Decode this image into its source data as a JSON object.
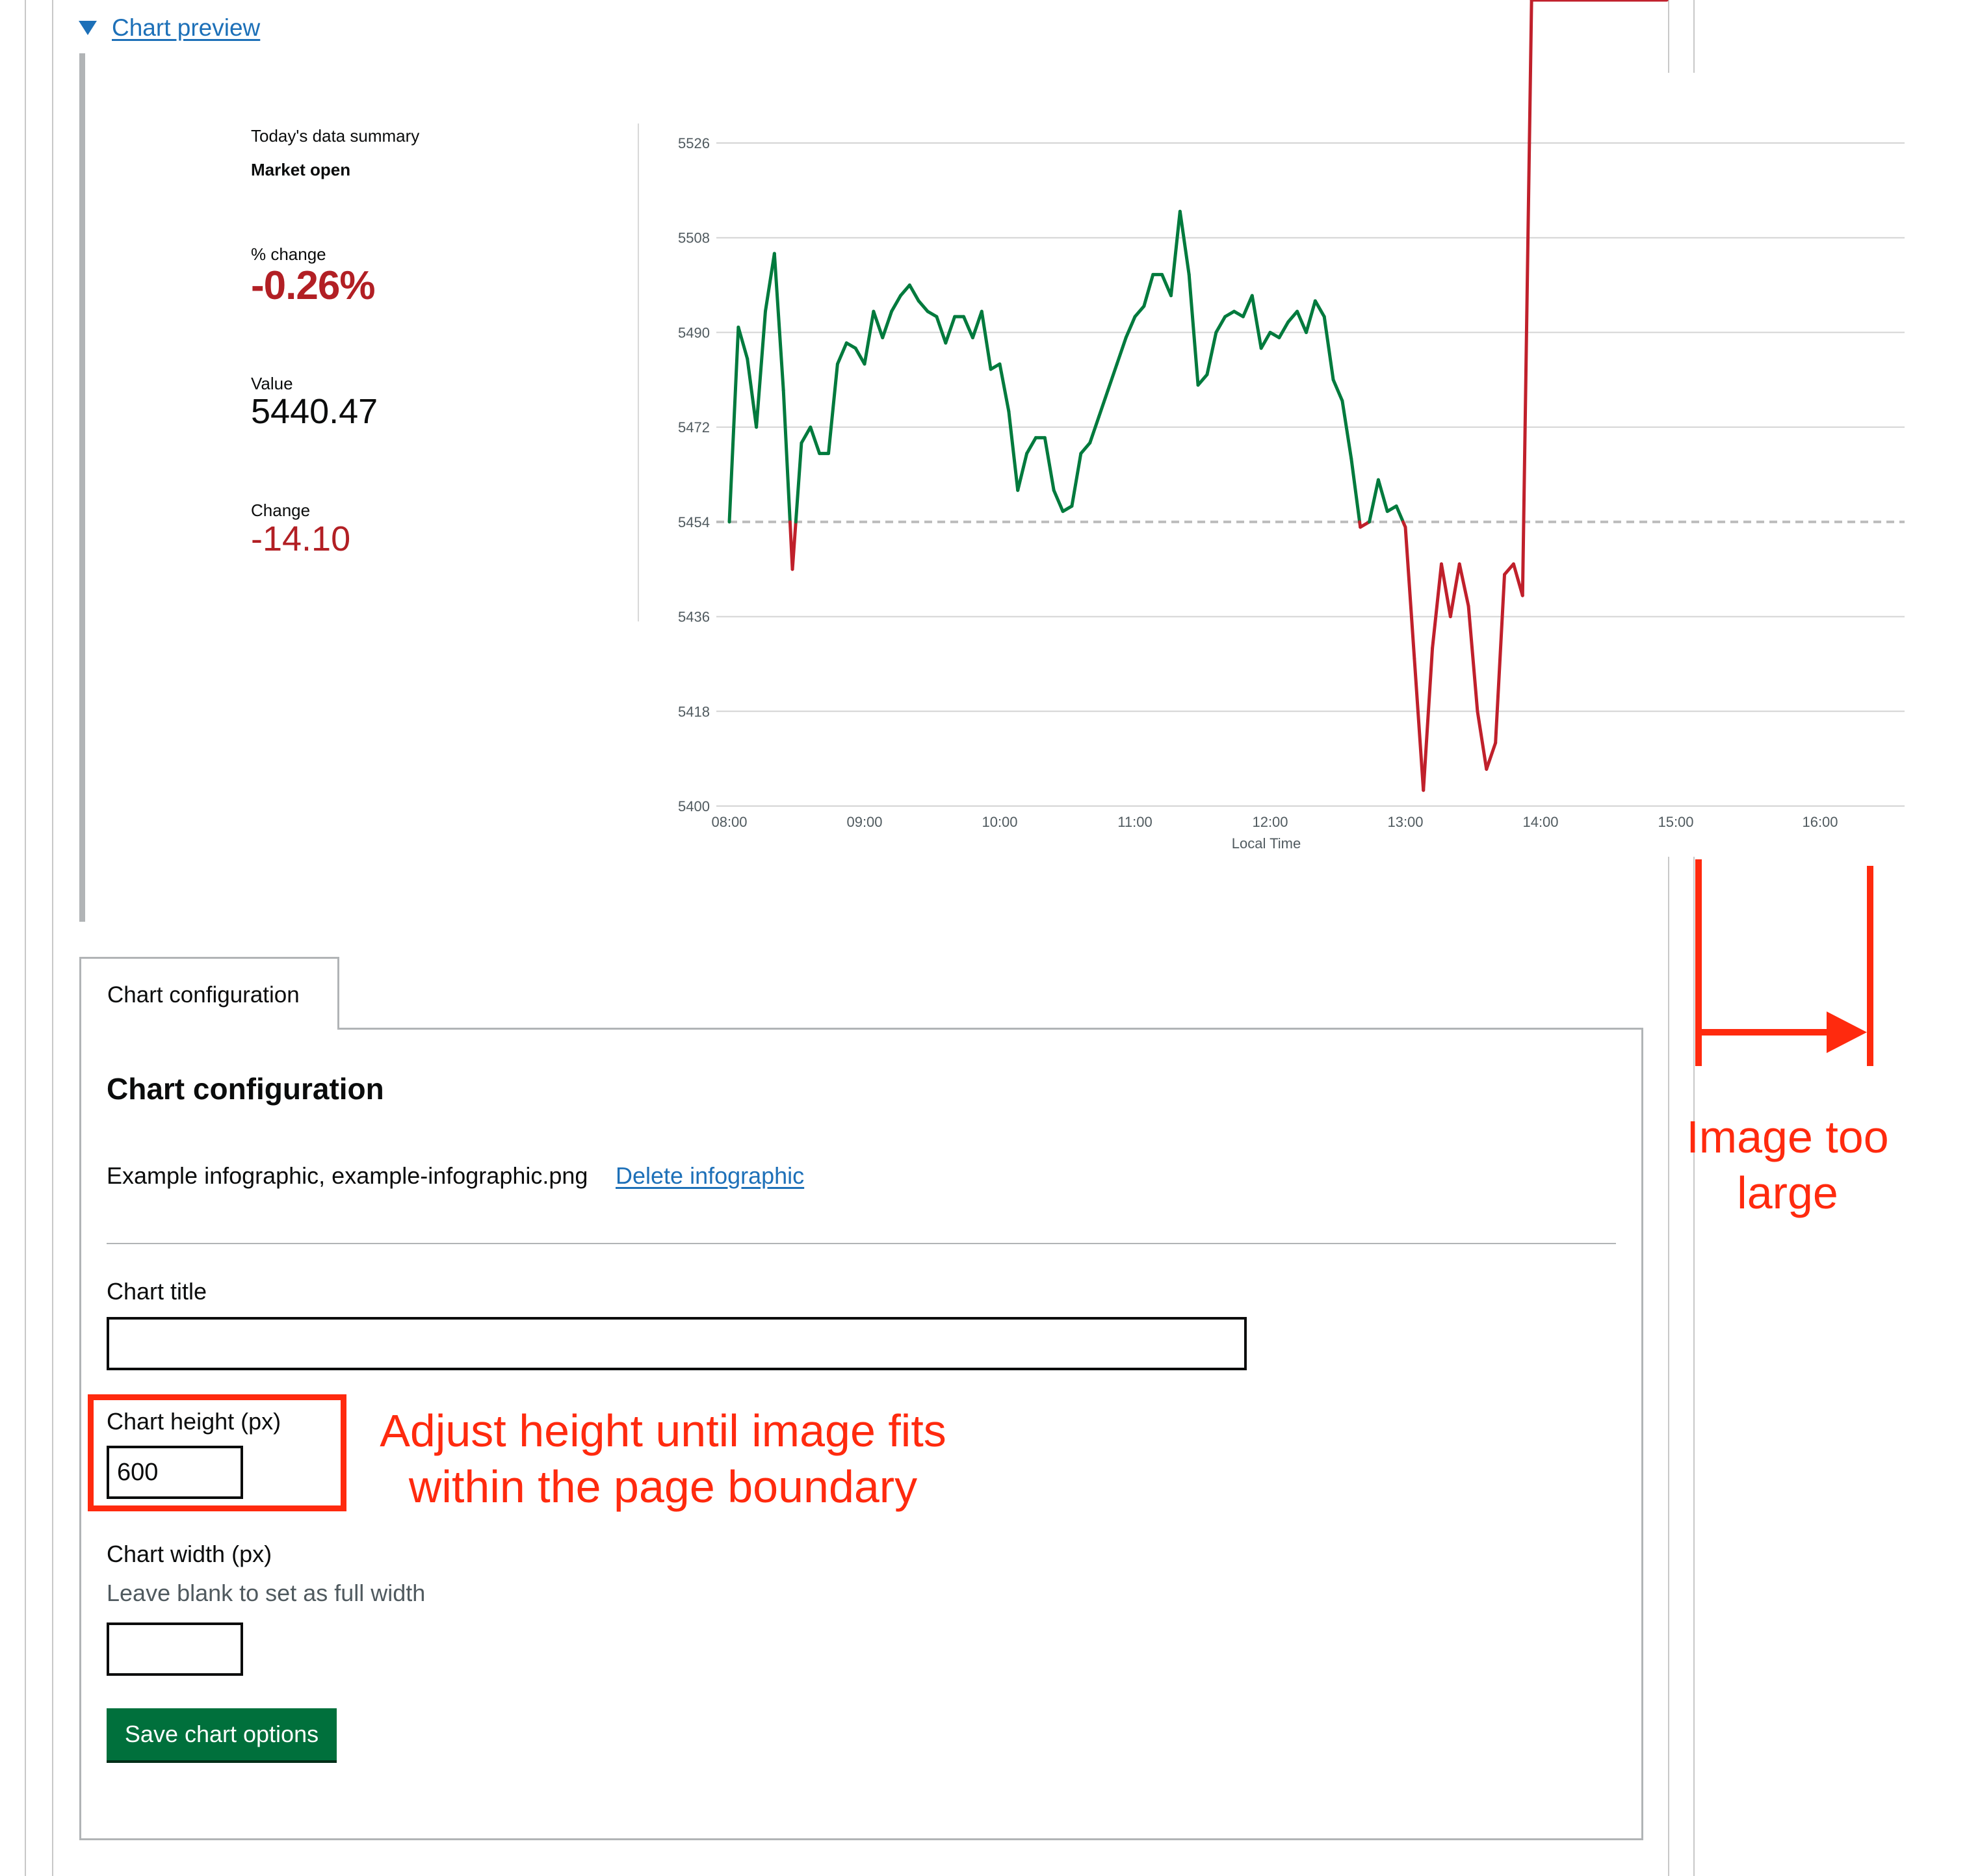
{
  "disclosure": {
    "label": "Chart preview"
  },
  "summary": {
    "title": "Today's data summary",
    "status": "Market open",
    "pct_label": "% change",
    "pct_value": "-0.26%",
    "value_label": "Value",
    "value": "5440.47",
    "change_label": "Change",
    "change_value": "-14.10"
  },
  "chart_data": {
    "type": "line",
    "xlabel": "Local Time",
    "x_tick_labels": [
      "08:00",
      "09:00",
      "10:00",
      "11:00",
      "12:00",
      "13:00",
      "14:00",
      "15:00",
      "16:00"
    ],
    "y_tick_labels": [
      "5526",
      "5508",
      "5490",
      "5472",
      "5454",
      "5436",
      "5418",
      "5400"
    ],
    "ylim": [
      5400,
      5526
    ],
    "baseline": 5454,
    "colors": {
      "above": "#007a3d",
      "below": "#c0202b",
      "grid": "#d4d4d4",
      "baseline": "#bdbdbd"
    },
    "series": [
      {
        "x_minutes": [
          0,
          4,
          8,
          12,
          16,
          20,
          24,
          28,
          32,
          36,
          40,
          44,
          48,
          52,
          56,
          60,
          64,
          68,
          72,
          76,
          80,
          84,
          88,
          92,
          96,
          100,
          104,
          108,
          112,
          116,
          120,
          124,
          128,
          132,
          136,
          140,
          144,
          148,
          152,
          156,
          160,
          164,
          168,
          172,
          176,
          180,
          184,
          188,
          192,
          196,
          200,
          204,
          208,
          212,
          216,
          220,
          224,
          228,
          232,
          236,
          240,
          244,
          248,
          252,
          256,
          260,
          264,
          268,
          272,
          276,
          280,
          284,
          288,
          292,
          296,
          300,
          304,
          308,
          312,
          316,
          320,
          324,
          328,
          332,
          336,
          340,
          344,
          348,
          352,
          356,
          360,
          364,
          368,
          372,
          376,
          380,
          384,
          388,
          392,
          396,
          400,
          404,
          408,
          412,
          416
        ],
        "values": [
          5454,
          5491,
          5485,
          5472,
          5494,
          5505,
          5479,
          5445,
          5469,
          5472,
          5467,
          5467,
          5484,
          5488,
          5487,
          5484,
          5494,
          5489,
          5494,
          5497,
          5499,
          5496,
          5494,
          5493,
          5488,
          5493,
          5493,
          5489,
          5494,
          5483,
          5484,
          5475,
          5460,
          5467,
          5470,
          5470,
          5460,
          5456,
          5457,
          5467,
          5469,
          5474,
          5479,
          5484,
          5489,
          5493,
          5495,
          5501,
          5501,
          5497,
          5513,
          5501,
          5480,
          5482,
          5490,
          5493,
          5494,
          5493,
          5497,
          5487,
          5490,
          5489,
          5492,
          5494,
          5490,
          5496,
          5493,
          5481,
          5477,
          5466,
          5453,
          5454,
          5462,
          5456,
          5457,
          5453,
          5428,
          5403,
          5430,
          5446,
          5436,
          5446,
          5438,
          5418,
          5407,
          5412,
          5444,
          5446,
          5440
        ]
      }
    ]
  },
  "config": {
    "tab_label": "Chart configuration",
    "heading": "Chart configuration",
    "infographic_text": "Example infographic, example-infographic.png",
    "delete_link": "Delete infographic",
    "title_label": "Chart title",
    "title_value": "",
    "height_label": "Chart height (px)",
    "height_value": "600",
    "width_label": "Chart width (px)",
    "width_hint": "Leave blank to set as full width",
    "width_value": "",
    "save_button": "Save chart options"
  },
  "annotations": {
    "height_note_line1": "Adjust height until image fits",
    "height_note_line2": "within the page boundary",
    "size_note_line1": "Image too",
    "size_note_line2": "large",
    "color": "#ff2a0e"
  }
}
